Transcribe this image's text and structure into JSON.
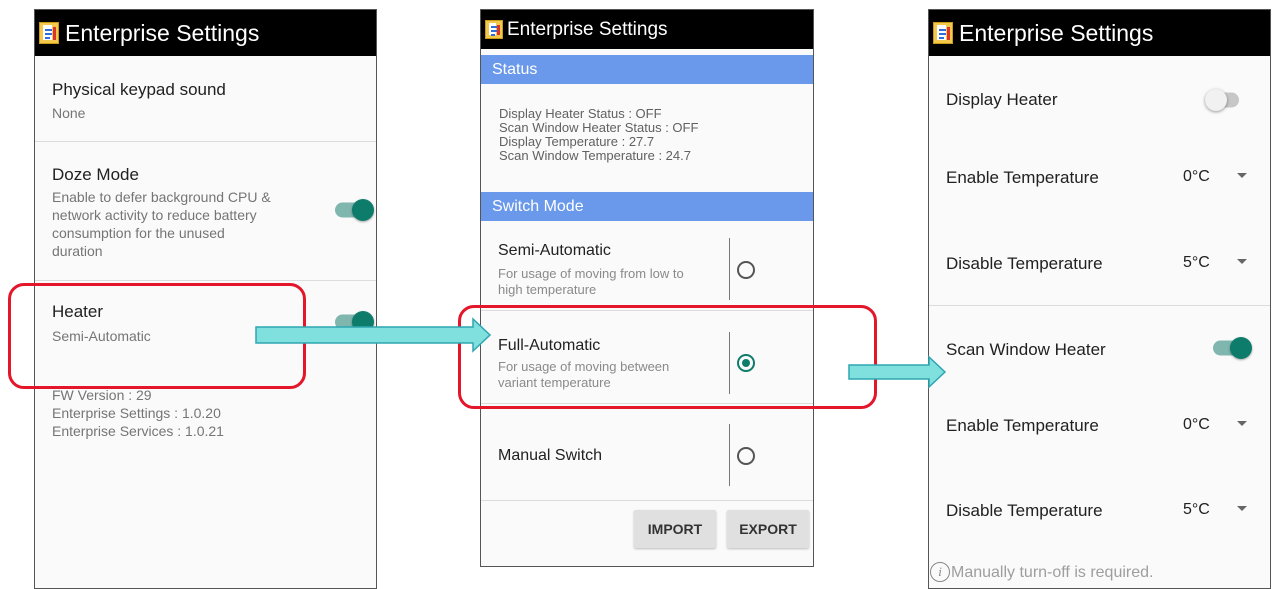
{
  "app_title": "Enterprise Settings",
  "colors": {
    "accent": "#0e7c6b",
    "section_header": "#6a98ea",
    "highlight": "#e3162a",
    "arrow": "#7fe0de"
  },
  "left": {
    "keypad": {
      "title": "Physical keypad sound",
      "value": "None"
    },
    "doze": {
      "title": "Doze Mode",
      "desc": [
        "Enable to defer background CPU &",
        "network activity to reduce battery",
        "consumption for the unused",
        "duration"
      ],
      "enabled": true
    },
    "heater": {
      "title": "Heater",
      "value": "Semi-Automatic",
      "enabled": true
    },
    "versions": [
      "FW Version : 29",
      "Enterprise Settings : 1.0.20",
      "Enterprise Services : 1.0.21"
    ]
  },
  "middle": {
    "status_header": "Status",
    "status_lines": [
      "Display Heater Status : OFF",
      "Scan Window Heater Status : OFF",
      "Display Temperature : 27.7",
      "Scan Window Temperature : 24.7"
    ],
    "switch_header": "Switch Mode",
    "modes": [
      {
        "title": "Semi-Automatic",
        "desc": [
          "For usage of moving from low to",
          "high temperature"
        ],
        "selected": false
      },
      {
        "title": "Full-Automatic",
        "desc": [
          "For usage of moving between",
          "variant temperature"
        ],
        "selected": true
      },
      {
        "title": "Manual Switch",
        "desc": [],
        "selected": false
      }
    ],
    "import_label": "IMPORT",
    "export_label": "EXPORT"
  },
  "right": {
    "display_heater": {
      "label": "Display Heater",
      "enabled": false
    },
    "display_enable_temp": {
      "label": "Enable Temperature",
      "value": "0°C"
    },
    "display_disable_temp": {
      "label": "Disable Temperature",
      "value": "5°C"
    },
    "scan_window_heater": {
      "label": "Scan Window Heater",
      "enabled": true
    },
    "scan_enable_temp": {
      "label": "Enable Temperature",
      "value": "0°C"
    },
    "scan_disable_temp": {
      "label": "Disable Temperature",
      "value": "5°C"
    },
    "info_icon": "info-icon",
    "info_glyph": "i",
    "note": "Manually turn-off is required."
  }
}
